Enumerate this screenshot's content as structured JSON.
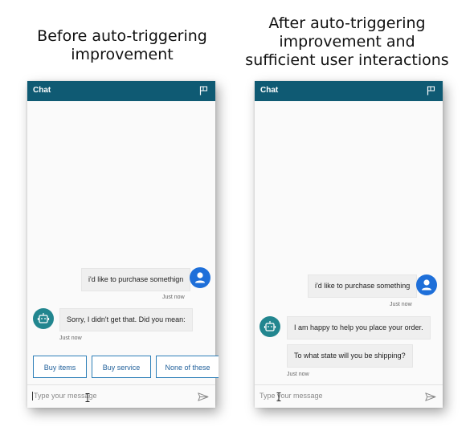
{
  "captions": {
    "left_line1": "Before auto-triggering",
    "left_line2": "improvement",
    "right_line1": "After auto-triggering",
    "right_line2": "improvement and",
    "right_line3": "sufficient user interactions"
  },
  "colors": {
    "header": "#0f5a73",
    "user_avatar": "#1e6fd9",
    "bot_avatar": "#22868f",
    "suggestion_border": "#2d7fb8"
  },
  "left_chat": {
    "title": "Chat",
    "header_icon": "flag-icon",
    "user_message": "i'd like to purchase somethign",
    "user_timestamp": "Just now",
    "bot_message": "Sorry, I didn't get that. Did you mean:",
    "bot_timestamp": "Just now",
    "suggestions": [
      "Buy items",
      "Buy service",
      "None of these"
    ],
    "input_placeholder": "Type your message",
    "send_icon": "send-icon"
  },
  "right_chat": {
    "title": "Chat",
    "header_icon": "flag-icon",
    "user_message": "i'd like to purchase something",
    "user_timestamp": "Just now",
    "bot_message_1": "I am happy to help you place your order.",
    "bot_message_2": "To what state will you be shipping?",
    "bot_timestamp": "Just now",
    "input_placeholder": "Type your message",
    "send_icon": "send-icon"
  }
}
